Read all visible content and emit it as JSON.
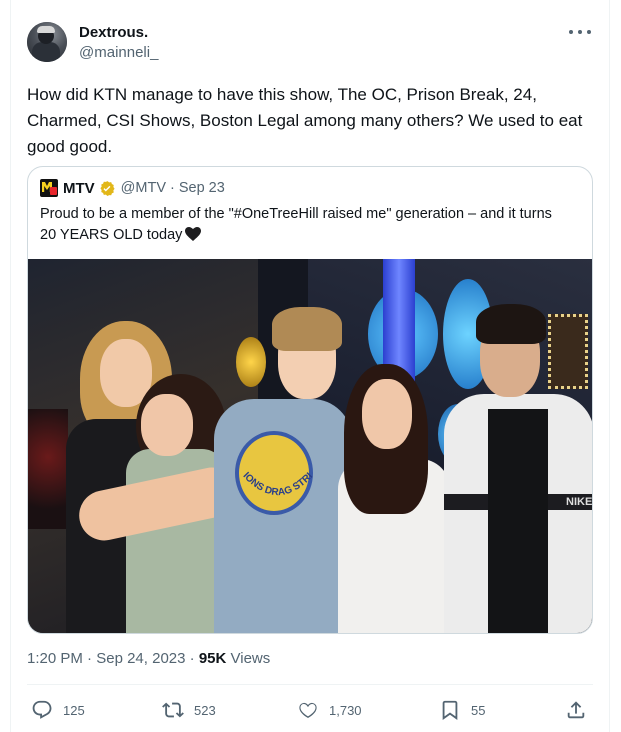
{
  "tweet": {
    "author": {
      "display_name": "Dextrous.",
      "handle": "@mainneli_"
    },
    "text": "How did KTN manage to have this show, The OC, Prison Break, 24, Charmed, CSI Shows, Boston Legal among many others? We used to eat good good.",
    "time": "1:20 PM",
    "date": "Sep 24, 2023",
    "views_count": "95K",
    "views_label": "Views",
    "more_icon": "more-horizontal-icon"
  },
  "quote": {
    "name": "MTV",
    "handle": "@MTV",
    "date": "Sep 23",
    "text": "Proud to be a member of the \"#OneTreeHill raised me\" generation – and it turns 20 YEARS OLD today",
    "emoji": "black-heart-icon",
    "verified_color": "#e2b719",
    "photo_print_text": "LIONS DRAG STRIP",
    "jacket_text": "NIKE"
  },
  "actions": {
    "replies": "125",
    "retweets": "523",
    "likes": "1,730",
    "bookmarks": "55"
  },
  "colors": {
    "text_primary": "#0f1419",
    "text_secondary": "#536471",
    "border": "#cfd9de"
  }
}
